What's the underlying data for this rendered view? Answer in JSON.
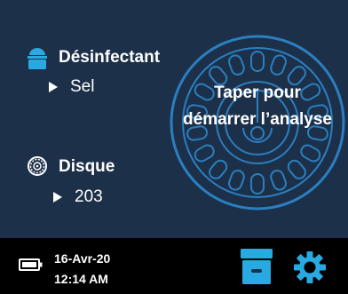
{
  "colors": {
    "panel_background": "#1d3049",
    "status_background": "#000000",
    "accent": "#1e9ad6",
    "text": "#ffffff"
  },
  "disinfectant": {
    "icon": "disinfectant-icon",
    "label": "Désinfectant",
    "value": "Sel"
  },
  "disc": {
    "icon": "disc-icon",
    "label": "Disque",
    "value": "203"
  },
  "start_button": {
    "icon": "disc-outline-icon",
    "line1": "Taper pour",
    "line2": "démarrer l’analyse"
  },
  "status": {
    "battery_icon": "battery-full-icon",
    "date": "16-Avr-20",
    "time": "12:14 AM",
    "archive_icon": "archive-icon",
    "settings_icon": "gear-icon"
  }
}
